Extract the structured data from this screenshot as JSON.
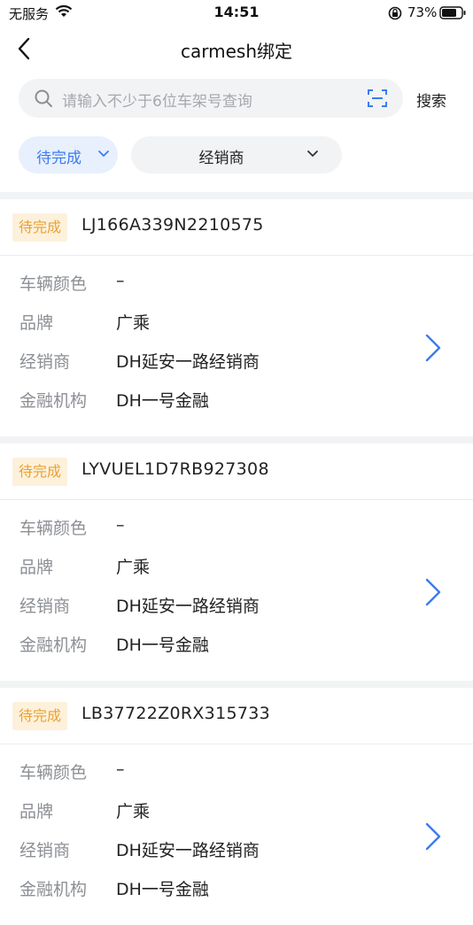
{
  "status_bar": {
    "carrier": "无服务",
    "time": "14:51",
    "battery": "73%"
  },
  "nav": {
    "title": "carmesh绑定"
  },
  "search": {
    "placeholder": "请输入不少于6位车架号查询",
    "button": "搜索"
  },
  "filters": {
    "status": "待完成",
    "dealer": "经销商"
  },
  "labels": {
    "color": "车辆颜色",
    "brand": "品牌",
    "dealer": "经销商",
    "finance": "金融机构"
  },
  "records": [
    {
      "status": "待完成",
      "vin": "LJ166A339N2210575",
      "color": "–",
      "brand": "广乘",
      "dealer": "DH延安一路经销商",
      "finance": "DH一号金融"
    },
    {
      "status": "待完成",
      "vin": "LYVUEL1D7RB927308",
      "color": "–",
      "brand": "广乘",
      "dealer": "DH延安一路经销商",
      "finance": "DH一号金融"
    },
    {
      "status": "待完成",
      "vin": "LB37722Z0RX315733",
      "color": "–",
      "brand": "广乘",
      "dealer": "DH延安一路经销商",
      "finance": "DH一号金融"
    }
  ],
  "colors": {
    "accent": "#3a7cf0",
    "badge_bg": "#fdf1dc",
    "badge_text": "#eaa232",
    "divider": "#f2f3f5"
  }
}
